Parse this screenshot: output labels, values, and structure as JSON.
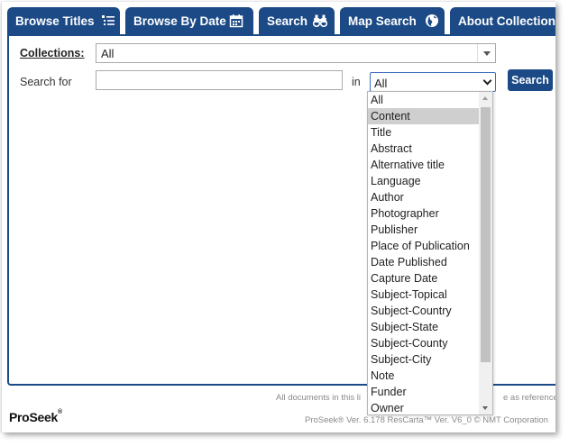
{
  "tabs": [
    {
      "label": "Browse Titles",
      "icon": "list-icon"
    },
    {
      "label": "Browse By Date",
      "icon": "calendar-icon"
    },
    {
      "label": "Search",
      "icon": "binoculars-icon"
    },
    {
      "label": "Map Search",
      "icon": "globe-icon"
    },
    {
      "label": "About Collections",
      "icon": ""
    }
  ],
  "form": {
    "collections_label": "Collections:",
    "collections_value": "All",
    "search_for_label": "Search for",
    "search_value": "",
    "in_label": "in",
    "field_value": "All",
    "search_button": "Search"
  },
  "dropdown": {
    "highlighted": "Content",
    "options": [
      "All",
      "Content",
      "Title",
      "Abstract",
      "Alternative title",
      "Language",
      "Author",
      "Photographer",
      "Publisher",
      "Place of Publication",
      "Date Published",
      "Capture Date",
      "Subject-Topical",
      "Subject-Country",
      "Subject-State",
      "Subject-County",
      "Subject-City",
      "Note",
      "Funder",
      "Owner"
    ]
  },
  "footer": {
    "note_left": "All documents in this li",
    "note_right": "e as reference m",
    "logo": "ProSeek",
    "logo_mark": "®",
    "version": "ProSeek® Ver. 6.178  ResCarta™ Ver. V6_0 © NMT Corporation"
  },
  "colors": {
    "brand": "#1b4a86",
    "highlight": "#cfcfcf"
  }
}
